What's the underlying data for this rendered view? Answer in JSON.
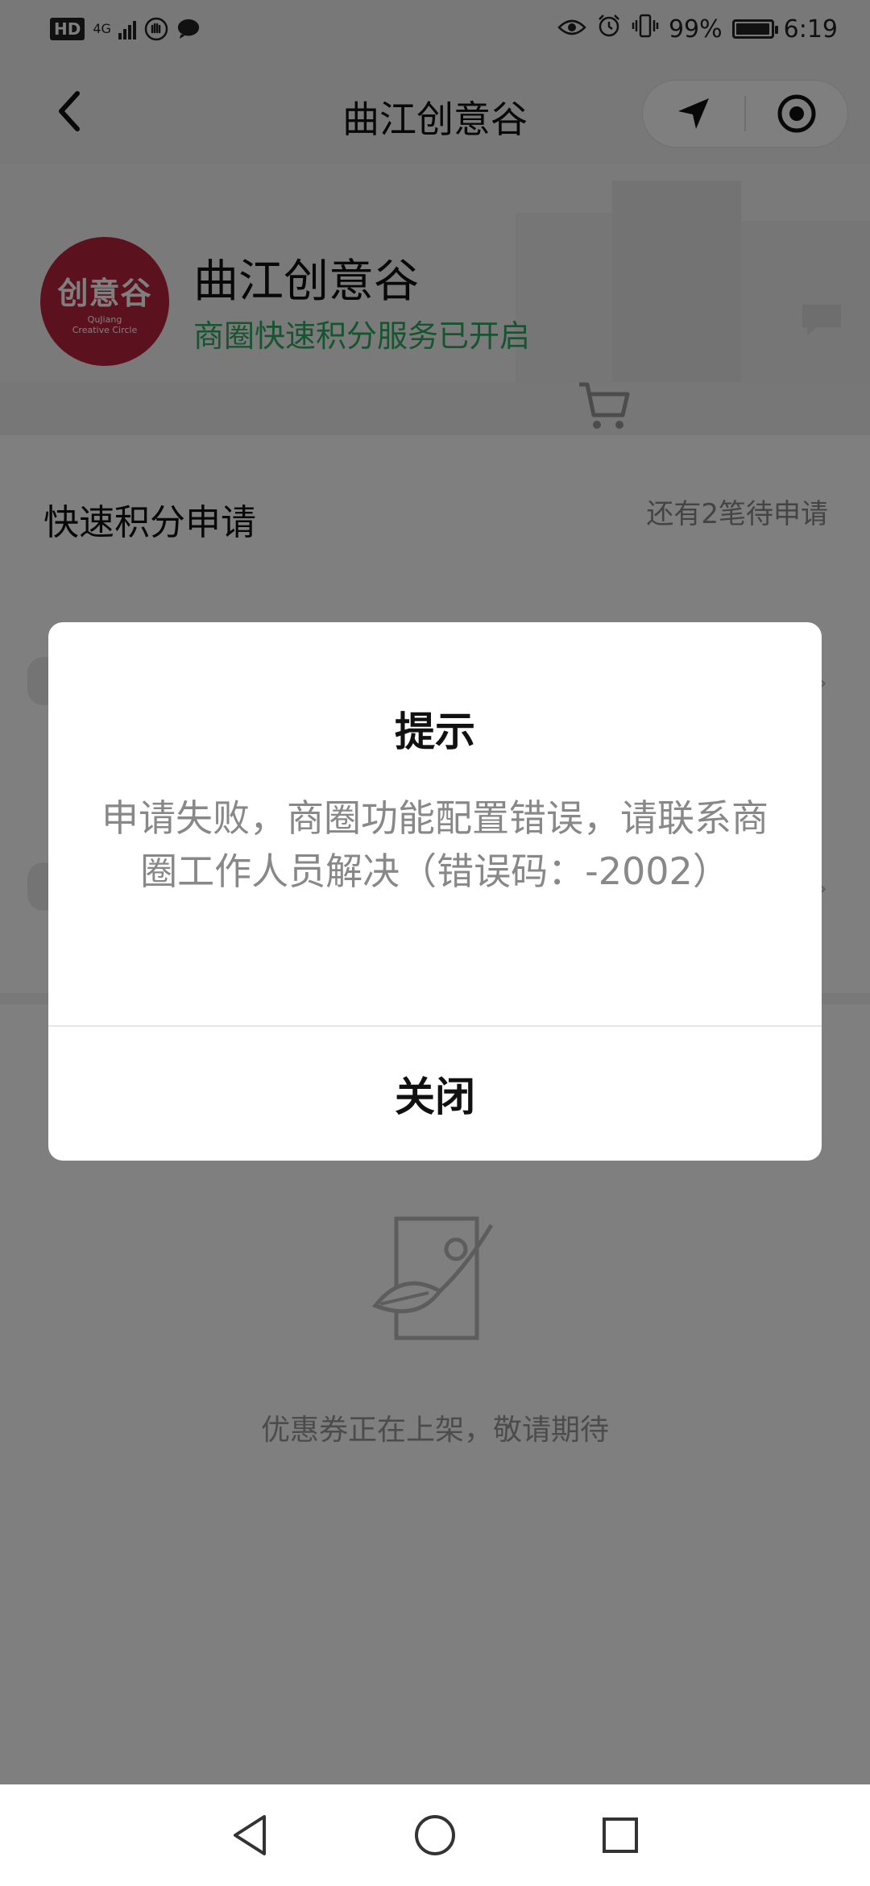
{
  "status_bar": {
    "hd": "HD",
    "network": "4G",
    "battery_level": 0.99,
    "battery_pct": "99%",
    "time": "6:19",
    "icons": [
      "hd-icon",
      "signal-icon",
      "hand-icon",
      "chat-bubble-icon",
      "eye-icon",
      "alarm-icon",
      "vibrate-icon",
      "battery-icon"
    ]
  },
  "nav": {
    "title": "曲江创意谷",
    "back_icon": "chevron-left-icon",
    "capsule_icons": [
      "location-arrow-icon",
      "target-icon"
    ]
  },
  "header": {
    "logo_text": "创意谷",
    "logo_sub": "QuJiang\nCreative Circle",
    "mall_name": "曲江创意谷",
    "status": "商圈快速积分服务已开启"
  },
  "content": {
    "section_title": "快速积分申请",
    "pending": "还有2笔待申请",
    "coupon_empty": "优惠券正在上架，敬请期待"
  },
  "dialog": {
    "title": "提示",
    "message": "申请失败，商圈功能配置错误，请联系商圈工作人员解决（错误码：-2002）",
    "button": "关闭"
  },
  "system_nav": {
    "icons": [
      "back-triangle-icon",
      "home-circle-icon",
      "recents-square-icon"
    ]
  },
  "colors": {
    "accent_green": "#2ea860",
    "logo_red": "#b8243c",
    "overlay": "rgba(0,0,0,0.5)"
  }
}
